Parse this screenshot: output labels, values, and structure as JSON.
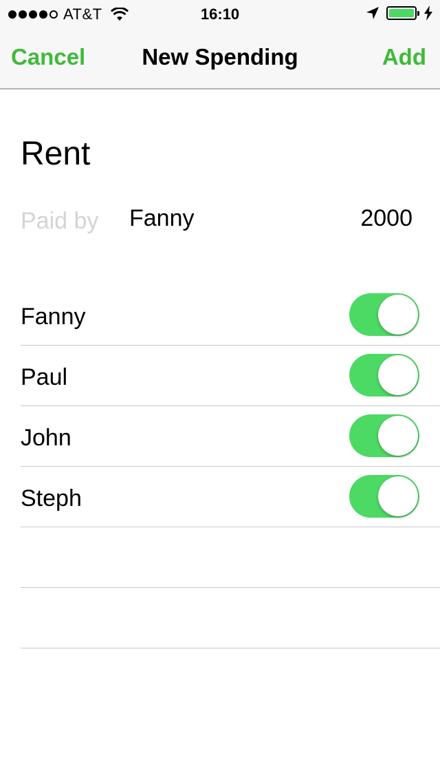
{
  "status_bar": {
    "carrier": "AT&T",
    "time": "16:10",
    "signal_bars_filled": 4,
    "signal_bars_total": 5,
    "battery_level": 1.0,
    "battery_color": "#4cd964"
  },
  "nav": {
    "cancel_label": "Cancel",
    "title": "New Spending",
    "add_label": "Add",
    "accent_color": "#3fba3a"
  },
  "spending": {
    "name": "Rent",
    "paid_by_label": "Paid by",
    "payer": "Fanny",
    "amount": "2000"
  },
  "participants": [
    {
      "name": "Fanny",
      "included": true
    },
    {
      "name": "Paul",
      "included": true
    },
    {
      "name": "John",
      "included": true
    },
    {
      "name": "Steph",
      "included": true
    }
  ],
  "toggle_on_color": "#4cd964",
  "icons": {
    "wifi": "wifi-icon",
    "location": "location-arrow-icon",
    "battery": "battery-icon",
    "charging": "charging-bolt-icon"
  }
}
